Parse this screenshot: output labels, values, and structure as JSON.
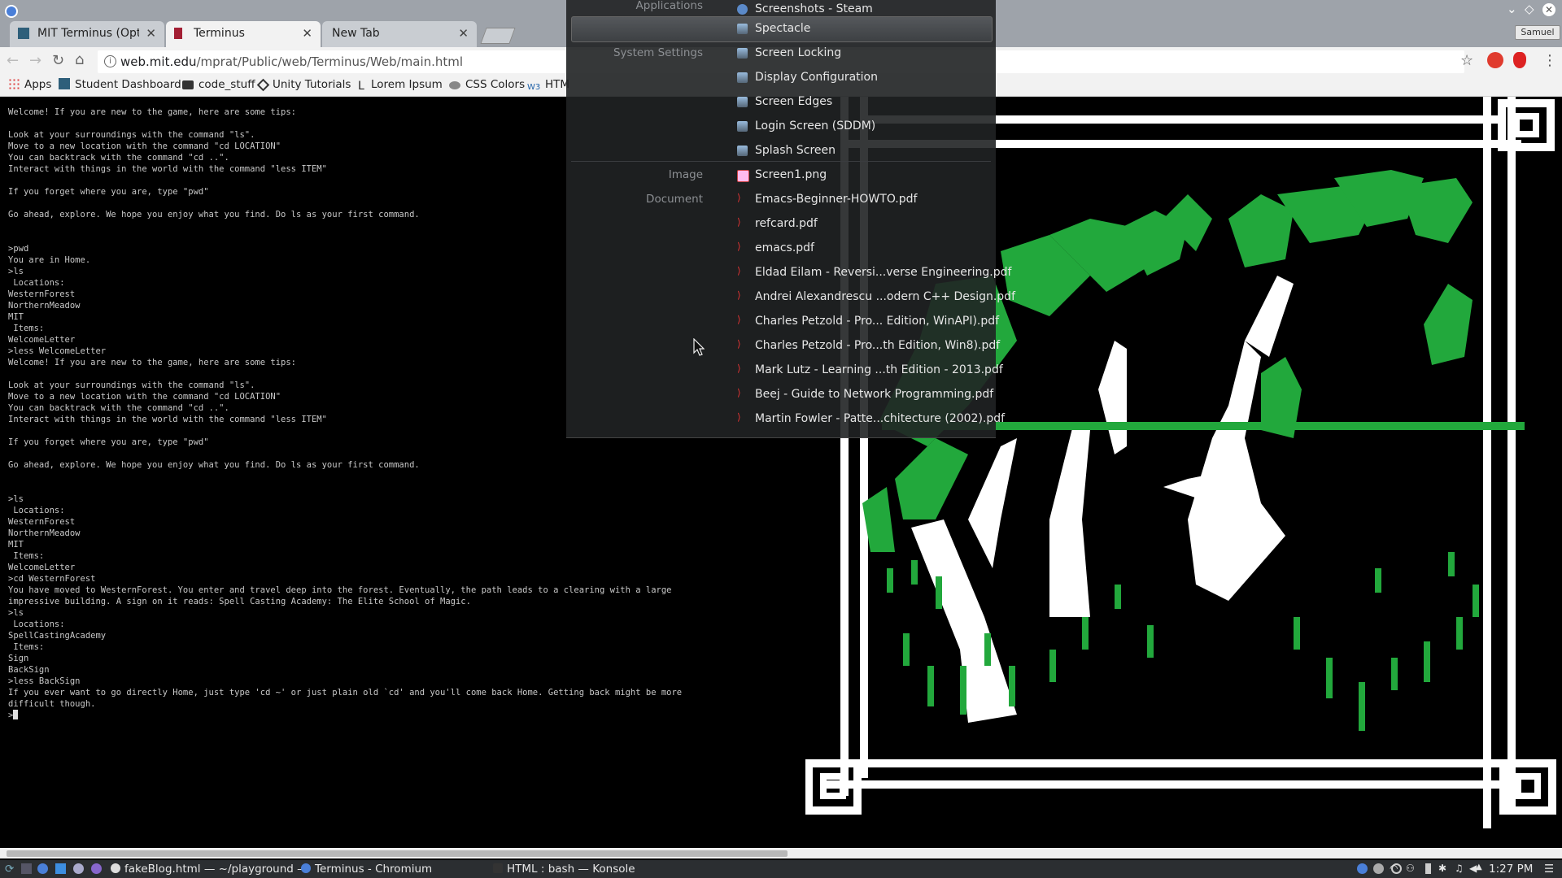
{
  "tabs": [
    {
      "label": "MIT Terminus (Option",
      "active": false
    },
    {
      "label": "Terminus",
      "active": true
    },
    {
      "label": "New Tab",
      "active": false
    }
  ],
  "window": {
    "user": "Samuel"
  },
  "toolbar": {
    "url_host": "web.mit.edu",
    "url_path": "/mprat/Public/web/Terminus/Web/main.html"
  },
  "bookmarks": [
    "Apps",
    "Student Dashboard",
    "code_stuff",
    "Unity Tutorials",
    "Lorem Ipsum",
    "CSS Colors",
    "HTM"
  ],
  "terminal": {
    "lines": "Welcome! If you are new to the game, here are some tips:\n\nLook at your surroundings with the command \"ls\".\nMove to a new location with the command \"cd LOCATION\"\nYou can backtrack with the command \"cd ..\".\nInteract with things in the world with the command \"less ITEM\"\n\nIf you forget where you are, type \"pwd\"\n\nGo ahead, explore. We hope you enjoy what you find. Do ls as your first command.\n\n\n>pwd\nYou are in Home.\n>ls\n Locations:\nWesternForest\nNorthernMeadow\nMIT\n Items:\nWelcomeLetter\n>less WelcomeLetter\nWelcome! If you are new to the game, here are some tips:\n\nLook at your surroundings with the command \"ls\".\nMove to a new location with the command \"cd LOCATION\"\nYou can backtrack with the command \"cd ..\".\nInteract with things in the world with the command \"less ITEM\"\n\nIf you forget where you are, type \"pwd\"\n\nGo ahead, explore. We hope you enjoy what you find. Do ls as your first command.\n\n\n>ls\n Locations:\nWesternForest\nNorthernMeadow\nMIT\n Items:\nWelcomeLetter\n>cd WesternForest\nYou have moved to WesternForest. You enter and travel deep into the forest. Eventually, the path leads to a clearing with a large\nimpressive building. A sign on it reads: Spell Casting Academy: The Elite School of Magic.\n>ls\n Locations:\nSpellCastingAcademy\n Items:\nSign\nBackSign\n>less BackSign\nIf you ever want to go directly Home, just type 'cd ~' or just plain old `cd' and you'll come back Home. Getting back might be more\ndifficult though.",
    "prompt": ">"
  },
  "launcher": {
    "categories": [
      "Applications",
      "System Settings",
      "Image",
      "Document"
    ],
    "items": [
      {
        "label": "Screenshots - Steam",
        "icon": "steam-icon"
      },
      {
        "label": "Spectacle",
        "icon": "spectacle-icon"
      },
      {
        "label": "Screen Locking",
        "icon": "lock-icon"
      },
      {
        "label": "Display Configuration",
        "icon": "display-icon"
      },
      {
        "label": "Screen Edges",
        "icon": "edges-icon"
      },
      {
        "label": "Login Screen (SDDM)",
        "icon": "login-icon"
      },
      {
        "label": "Splash Screen",
        "icon": "splash-icon"
      },
      {
        "label": "Screen1.png",
        "icon": "image-icon"
      },
      {
        "label": "Emacs-Beginner-HOWTO.pdf",
        "icon": "pdf-icon"
      },
      {
        "label": "refcard.pdf",
        "icon": "pdf-icon"
      },
      {
        "label": "emacs.pdf",
        "icon": "pdf-icon"
      },
      {
        "label": "Eldad Eilam - Reversi...verse Engineering.pdf",
        "icon": "pdf-icon"
      },
      {
        "label": "Andrei Alexandrescu ...odern C++ Design.pdf",
        "icon": "pdf-icon"
      },
      {
        "label": "Charles Petzold - Pro... Edition, WinAPI).pdf",
        "icon": "pdf-icon"
      },
      {
        "label": "Charles Petzold - Pro...th Edition, Win8).pdf",
        "icon": "pdf-icon"
      },
      {
        "label": "Mark Lutz - Learning ...th Edition - 2013.pdf",
        "icon": "pdf-icon"
      },
      {
        "label": "Beej - Guide to Network Programming.pdf",
        "icon": "pdf-icon"
      },
      {
        "label": "Martin Fowler - Patte...chitecture (2002).pdf",
        "icon": "pdf-icon"
      }
    ]
  },
  "taskbar": {
    "tasks": [
      "fakeBlog.html — ~/playground —",
      "Terminus - Chromium",
      "HTML : bash — Konsole"
    ],
    "clock": "1:27 PM"
  },
  "colors": {
    "tree_green": "#22a83c",
    "terminal_text": "#c8c8c8"
  }
}
